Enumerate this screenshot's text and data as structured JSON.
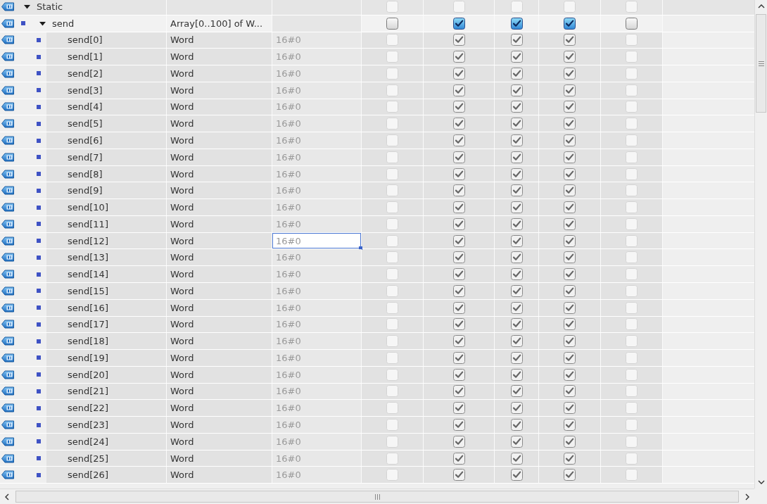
{
  "tree": [
    {
      "kind": "section",
      "name": "Static",
      "expanded": true,
      "checks": [
        {
          "checked": false,
          "disabled": true
        },
        {
          "checked": false,
          "disabled": true
        },
        {
          "checked": false,
          "disabled": true
        },
        {
          "checked": false,
          "disabled": true
        },
        {
          "checked": false,
          "disabled": true
        }
      ],
      "children": [
        {
          "kind": "array",
          "name": "send",
          "data_type": "Array[0..100] of W...",
          "expanded": true,
          "checks": [
            {
              "checked": false,
              "disabled": false
            },
            {
              "checked": true,
              "disabled": false
            },
            {
              "checked": true,
              "disabled": false
            },
            {
              "checked": true,
              "disabled": false
            },
            {
              "checked": false,
              "disabled": false
            }
          ],
          "children": [
            {
              "kind": "element",
              "name": "send[0]",
              "data_type": "Word",
              "start_value": {
                "text": "16#0",
                "selected": false
              },
              "checks": [
                {
                  "checked": false,
                  "disabled": true
                },
                {
                  "checked": true,
                  "disabled": true
                },
                {
                  "checked": true,
                  "disabled": true
                },
                {
                  "checked": true,
                  "disabled": true
                },
                {
                  "checked": false,
                  "disabled": true
                }
              ]
            },
            {
              "kind": "element",
              "name": "send[1]",
              "data_type": "Word",
              "start_value": {
                "text": "16#0",
                "selected": false
              },
              "checks": [
                {
                  "checked": false,
                  "disabled": true
                },
                {
                  "checked": true,
                  "disabled": true
                },
                {
                  "checked": true,
                  "disabled": true
                },
                {
                  "checked": true,
                  "disabled": true
                },
                {
                  "checked": false,
                  "disabled": true
                }
              ]
            },
            {
              "kind": "element",
              "name": "send[2]",
              "data_type": "Word",
              "start_value": {
                "text": "16#0",
                "selected": false
              },
              "checks": [
                {
                  "checked": false,
                  "disabled": true
                },
                {
                  "checked": true,
                  "disabled": true
                },
                {
                  "checked": true,
                  "disabled": true
                },
                {
                  "checked": true,
                  "disabled": true
                },
                {
                  "checked": false,
                  "disabled": true
                }
              ]
            },
            {
              "kind": "element",
              "name": "send[3]",
              "data_type": "Word",
              "start_value": {
                "text": "16#0",
                "selected": false
              },
              "checks": [
                {
                  "checked": false,
                  "disabled": true
                },
                {
                  "checked": true,
                  "disabled": true
                },
                {
                  "checked": true,
                  "disabled": true
                },
                {
                  "checked": true,
                  "disabled": true
                },
                {
                  "checked": false,
                  "disabled": true
                }
              ]
            },
            {
              "kind": "element",
              "name": "send[4]",
              "data_type": "Word",
              "start_value": {
                "text": "16#0",
                "selected": false
              },
              "checks": [
                {
                  "checked": false,
                  "disabled": true
                },
                {
                  "checked": true,
                  "disabled": true
                },
                {
                  "checked": true,
                  "disabled": true
                },
                {
                  "checked": true,
                  "disabled": true
                },
                {
                  "checked": false,
                  "disabled": true
                }
              ]
            },
            {
              "kind": "element",
              "name": "send[5]",
              "data_type": "Word",
              "start_value": {
                "text": "16#0",
                "selected": false
              },
              "checks": [
                {
                  "checked": false,
                  "disabled": true
                },
                {
                  "checked": true,
                  "disabled": true
                },
                {
                  "checked": true,
                  "disabled": true
                },
                {
                  "checked": true,
                  "disabled": true
                },
                {
                  "checked": false,
                  "disabled": true
                }
              ]
            },
            {
              "kind": "element",
              "name": "send[6]",
              "data_type": "Word",
              "start_value": {
                "text": "16#0",
                "selected": false
              },
              "checks": [
                {
                  "checked": false,
                  "disabled": true
                },
                {
                  "checked": true,
                  "disabled": true
                },
                {
                  "checked": true,
                  "disabled": true
                },
                {
                  "checked": true,
                  "disabled": true
                },
                {
                  "checked": false,
                  "disabled": true
                }
              ]
            },
            {
              "kind": "element",
              "name": "send[7]",
              "data_type": "Word",
              "start_value": {
                "text": "16#0",
                "selected": false
              },
              "checks": [
                {
                  "checked": false,
                  "disabled": true
                },
                {
                  "checked": true,
                  "disabled": true
                },
                {
                  "checked": true,
                  "disabled": true
                },
                {
                  "checked": true,
                  "disabled": true
                },
                {
                  "checked": false,
                  "disabled": true
                }
              ]
            },
            {
              "kind": "element",
              "name": "send[8]",
              "data_type": "Word",
              "start_value": {
                "text": "16#0",
                "selected": false
              },
              "checks": [
                {
                  "checked": false,
                  "disabled": true
                },
                {
                  "checked": true,
                  "disabled": true
                },
                {
                  "checked": true,
                  "disabled": true
                },
                {
                  "checked": true,
                  "disabled": true
                },
                {
                  "checked": false,
                  "disabled": true
                }
              ]
            },
            {
              "kind": "element",
              "name": "send[9]",
              "data_type": "Word",
              "start_value": {
                "text": "16#0",
                "selected": false
              },
              "checks": [
                {
                  "checked": false,
                  "disabled": true
                },
                {
                  "checked": true,
                  "disabled": true
                },
                {
                  "checked": true,
                  "disabled": true
                },
                {
                  "checked": true,
                  "disabled": true
                },
                {
                  "checked": false,
                  "disabled": true
                }
              ]
            },
            {
              "kind": "element",
              "name": "send[10]",
              "data_type": "Word",
              "start_value": {
                "text": "16#0",
                "selected": false
              },
              "checks": [
                {
                  "checked": false,
                  "disabled": true
                },
                {
                  "checked": true,
                  "disabled": true
                },
                {
                  "checked": true,
                  "disabled": true
                },
                {
                  "checked": true,
                  "disabled": true
                },
                {
                  "checked": false,
                  "disabled": true
                }
              ]
            },
            {
              "kind": "element",
              "name": "send[11]",
              "data_type": "Word",
              "start_value": {
                "text": "16#0",
                "selected": false
              },
              "checks": [
                {
                  "checked": false,
                  "disabled": true
                },
                {
                  "checked": true,
                  "disabled": true
                },
                {
                  "checked": true,
                  "disabled": true
                },
                {
                  "checked": true,
                  "disabled": true
                },
                {
                  "checked": false,
                  "disabled": true
                }
              ]
            },
            {
              "kind": "element",
              "name": "send[12]",
              "data_type": "Word",
              "start_value": {
                "text": "16#0",
                "selected": true
              },
              "checks": [
                {
                  "checked": false,
                  "disabled": true
                },
                {
                  "checked": true,
                  "disabled": true
                },
                {
                  "checked": true,
                  "disabled": true
                },
                {
                  "checked": true,
                  "disabled": true
                },
                {
                  "checked": false,
                  "disabled": true
                }
              ]
            },
            {
              "kind": "element",
              "name": "send[13]",
              "data_type": "Word",
              "start_value": {
                "text": "16#0",
                "selected": false
              },
              "checks": [
                {
                  "checked": false,
                  "disabled": true
                },
                {
                  "checked": true,
                  "disabled": true
                },
                {
                  "checked": true,
                  "disabled": true
                },
                {
                  "checked": true,
                  "disabled": true
                },
                {
                  "checked": false,
                  "disabled": true
                }
              ]
            },
            {
              "kind": "element",
              "name": "send[14]",
              "data_type": "Word",
              "start_value": {
                "text": "16#0",
                "selected": false
              },
              "checks": [
                {
                  "checked": false,
                  "disabled": true
                },
                {
                  "checked": true,
                  "disabled": true
                },
                {
                  "checked": true,
                  "disabled": true
                },
                {
                  "checked": true,
                  "disabled": true
                },
                {
                  "checked": false,
                  "disabled": true
                }
              ]
            },
            {
              "kind": "element",
              "name": "send[15]",
              "data_type": "Word",
              "start_value": {
                "text": "16#0",
                "selected": false
              },
              "checks": [
                {
                  "checked": false,
                  "disabled": true
                },
                {
                  "checked": true,
                  "disabled": true
                },
                {
                  "checked": true,
                  "disabled": true
                },
                {
                  "checked": true,
                  "disabled": true
                },
                {
                  "checked": false,
                  "disabled": true
                }
              ]
            },
            {
              "kind": "element",
              "name": "send[16]",
              "data_type": "Word",
              "start_value": {
                "text": "16#0",
                "selected": false
              },
              "checks": [
                {
                  "checked": false,
                  "disabled": true
                },
                {
                  "checked": true,
                  "disabled": true
                },
                {
                  "checked": true,
                  "disabled": true
                },
                {
                  "checked": true,
                  "disabled": true
                },
                {
                  "checked": false,
                  "disabled": true
                }
              ]
            },
            {
              "kind": "element",
              "name": "send[17]",
              "data_type": "Word",
              "start_value": {
                "text": "16#0",
                "selected": false
              },
              "checks": [
                {
                  "checked": false,
                  "disabled": true
                },
                {
                  "checked": true,
                  "disabled": true
                },
                {
                  "checked": true,
                  "disabled": true
                },
                {
                  "checked": true,
                  "disabled": true
                },
                {
                  "checked": false,
                  "disabled": true
                }
              ]
            },
            {
              "kind": "element",
              "name": "send[18]",
              "data_type": "Word",
              "start_value": {
                "text": "16#0",
                "selected": false
              },
              "checks": [
                {
                  "checked": false,
                  "disabled": true
                },
                {
                  "checked": true,
                  "disabled": true
                },
                {
                  "checked": true,
                  "disabled": true
                },
                {
                  "checked": true,
                  "disabled": true
                },
                {
                  "checked": false,
                  "disabled": true
                }
              ]
            },
            {
              "kind": "element",
              "name": "send[19]",
              "data_type": "Word",
              "start_value": {
                "text": "16#0",
                "selected": false
              },
              "checks": [
                {
                  "checked": false,
                  "disabled": true
                },
                {
                  "checked": true,
                  "disabled": true
                },
                {
                  "checked": true,
                  "disabled": true
                },
                {
                  "checked": true,
                  "disabled": true
                },
                {
                  "checked": false,
                  "disabled": true
                }
              ]
            },
            {
              "kind": "element",
              "name": "send[20]",
              "data_type": "Word",
              "start_value": {
                "text": "16#0",
                "selected": false
              },
              "checks": [
                {
                  "checked": false,
                  "disabled": true
                },
                {
                  "checked": true,
                  "disabled": true
                },
                {
                  "checked": true,
                  "disabled": true
                },
                {
                  "checked": true,
                  "disabled": true
                },
                {
                  "checked": false,
                  "disabled": true
                }
              ]
            },
            {
              "kind": "element",
              "name": "send[21]",
              "data_type": "Word",
              "start_value": {
                "text": "16#0",
                "selected": false
              },
              "checks": [
                {
                  "checked": false,
                  "disabled": true
                },
                {
                  "checked": true,
                  "disabled": true
                },
                {
                  "checked": true,
                  "disabled": true
                },
                {
                  "checked": true,
                  "disabled": true
                },
                {
                  "checked": false,
                  "disabled": true
                }
              ]
            },
            {
              "kind": "element",
              "name": "send[22]",
              "data_type": "Word",
              "start_value": {
                "text": "16#0",
                "selected": false
              },
              "checks": [
                {
                  "checked": false,
                  "disabled": true
                },
                {
                  "checked": true,
                  "disabled": true
                },
                {
                  "checked": true,
                  "disabled": true
                },
                {
                  "checked": true,
                  "disabled": true
                },
                {
                  "checked": false,
                  "disabled": true
                }
              ]
            },
            {
              "kind": "element",
              "name": "send[23]",
              "data_type": "Word",
              "start_value": {
                "text": "16#0",
                "selected": false
              },
              "checks": [
                {
                  "checked": false,
                  "disabled": true
                },
                {
                  "checked": true,
                  "disabled": true
                },
                {
                  "checked": true,
                  "disabled": true
                },
                {
                  "checked": true,
                  "disabled": true
                },
                {
                  "checked": false,
                  "disabled": true
                }
              ]
            },
            {
              "kind": "element",
              "name": "send[24]",
              "data_type": "Word",
              "start_value": {
                "text": "16#0",
                "selected": false
              },
              "checks": [
                {
                  "checked": false,
                  "disabled": true
                },
                {
                  "checked": true,
                  "disabled": true
                },
                {
                  "checked": true,
                  "disabled": true
                },
                {
                  "checked": true,
                  "disabled": true
                },
                {
                  "checked": false,
                  "disabled": true
                }
              ]
            },
            {
              "kind": "element",
              "name": "send[25]",
              "data_type": "Word",
              "start_value": {
                "text": "16#0",
                "selected": false
              },
              "checks": [
                {
                  "checked": false,
                  "disabled": true
                },
                {
                  "checked": true,
                  "disabled": true
                },
                {
                  "checked": true,
                  "disabled": true
                },
                {
                  "checked": true,
                  "disabled": true
                },
                {
                  "checked": false,
                  "disabled": true
                }
              ]
            },
            {
              "kind": "element",
              "name": "send[26]",
              "data_type": "Word",
              "start_value": {
                "text": "16#0",
                "selected": false
              },
              "checks": [
                {
                  "checked": false,
                  "disabled": true
                },
                {
                  "checked": true,
                  "disabled": true
                },
                {
                  "checked": true,
                  "disabled": true
                },
                {
                  "checked": true,
                  "disabled": true
                },
                {
                  "checked": false,
                  "disabled": true
                }
              ]
            }
          ]
        }
      ]
    }
  ]
}
